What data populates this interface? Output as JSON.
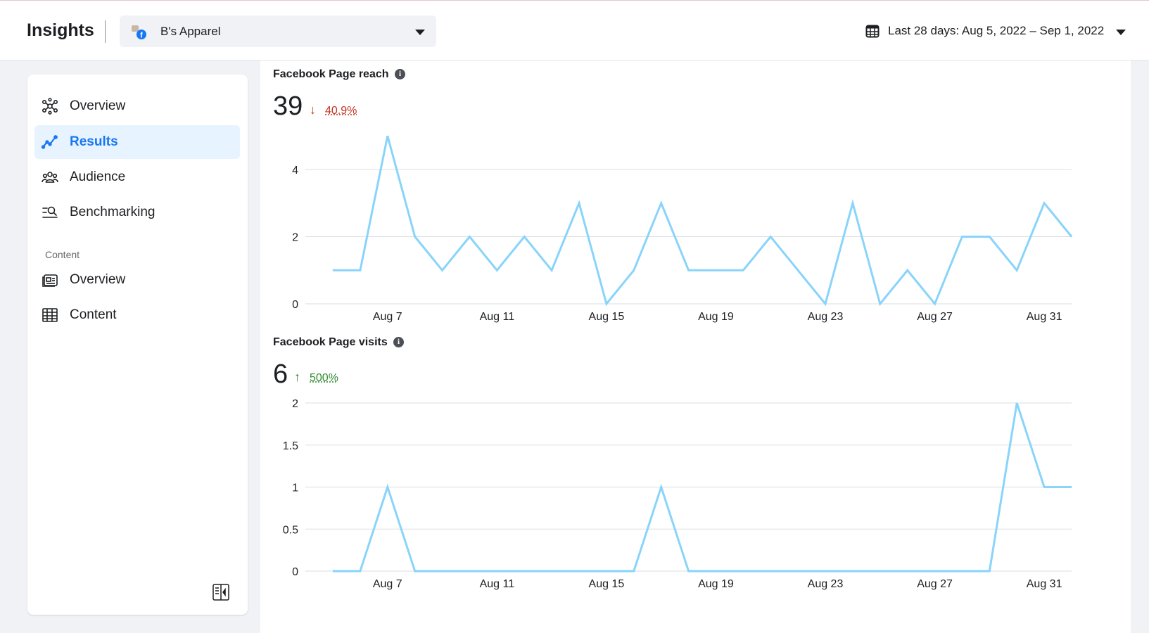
{
  "header": {
    "title": "Insights",
    "page_selector": {
      "label": "B's Apparel"
    },
    "date_range": {
      "label": "Last 28 days: Aug 5, 2022 – Sep 1, 2022"
    }
  },
  "sidebar": {
    "items": [
      {
        "label": "Overview",
        "icon": "network-icon"
      },
      {
        "label": "Results",
        "icon": "trend-icon",
        "active": true
      },
      {
        "label": "Audience",
        "icon": "people-icon"
      },
      {
        "label": "Benchmarking",
        "icon": "benchmark-icon"
      }
    ],
    "section_label": "Content",
    "content_items": [
      {
        "label": "Overview",
        "icon": "content-overview-icon"
      },
      {
        "label": "Content",
        "icon": "table-icon"
      }
    ]
  },
  "colors": {
    "accent": "#1877f2",
    "line": "#89d4fa",
    "down": "#c4301d",
    "up": "#2a8a2a"
  },
  "metrics": [
    {
      "title": "Facebook Page reach",
      "value": "39",
      "direction": "down",
      "arrow": "↓",
      "change": "40.9%"
    },
    {
      "title": "Facebook Page visits",
      "value": "6",
      "direction": "up",
      "arrow": "↑",
      "change": "500%"
    }
  ],
  "chart_data": [
    {
      "type": "line",
      "title": "Facebook Page reach",
      "x": [
        "Aug 5",
        "Aug 6",
        "Aug 7",
        "Aug 8",
        "Aug 9",
        "Aug 10",
        "Aug 11",
        "Aug 12",
        "Aug 13",
        "Aug 14",
        "Aug 15",
        "Aug 16",
        "Aug 17",
        "Aug 18",
        "Aug 19",
        "Aug 20",
        "Aug 21",
        "Aug 22",
        "Aug 23",
        "Aug 24",
        "Aug 25",
        "Aug 26",
        "Aug 27",
        "Aug 28",
        "Aug 29",
        "Aug 30",
        "Aug 31",
        "Sep 1"
      ],
      "series": [
        {
          "values": [
            1,
            1,
            5,
            2,
            1,
            2,
            1,
            2,
            1,
            3,
            0,
            1,
            3,
            1,
            1,
            1,
            2,
            1,
            0,
            3,
            0,
            1,
            0,
            2,
            2,
            1,
            3,
            2
          ]
        }
      ],
      "x_ticks": [
        "Aug 7",
        "Aug 11",
        "Aug 15",
        "Aug 19",
        "Aug 23",
        "Aug 27",
        "Aug 31"
      ],
      "y_ticks": [
        "0",
        "2",
        "4"
      ],
      "ylim": [
        0,
        4
      ],
      "grid": true
    },
    {
      "type": "line",
      "title": "Facebook Page visits",
      "x": [
        "Aug 5",
        "Aug 6",
        "Aug 7",
        "Aug 8",
        "Aug 9",
        "Aug 10",
        "Aug 11",
        "Aug 12",
        "Aug 13",
        "Aug 14",
        "Aug 15",
        "Aug 16",
        "Aug 17",
        "Aug 18",
        "Aug 19",
        "Aug 20",
        "Aug 21",
        "Aug 22",
        "Aug 23",
        "Aug 24",
        "Aug 25",
        "Aug 26",
        "Aug 27",
        "Aug 28",
        "Aug 29",
        "Aug 30",
        "Aug 31",
        "Sep 1"
      ],
      "series": [
        {
          "values": [
            0,
            0,
            1,
            0,
            0,
            0,
            0,
            0,
            0,
            0,
            0,
            0,
            1,
            0,
            0,
            0,
            0,
            0,
            0,
            0,
            0,
            0,
            0,
            0,
            0,
            2,
            1,
            1
          ]
        }
      ],
      "x_ticks": [
        "Aug 7",
        "Aug 11",
        "Aug 15",
        "Aug 19",
        "Aug 23",
        "Aug 27",
        "Aug 31"
      ],
      "y_ticks": [
        "0",
        "0.5",
        "1",
        "1.5",
        "2"
      ],
      "ylim": [
        0,
        2
      ],
      "grid": true
    }
  ]
}
